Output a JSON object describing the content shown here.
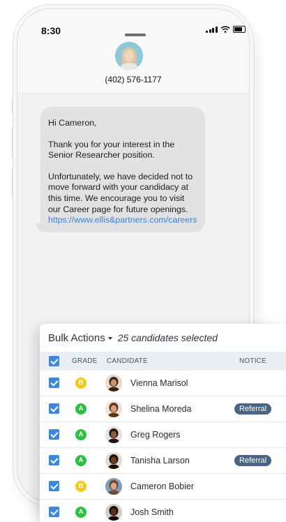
{
  "phone": {
    "status_time": "8:30",
    "contact_number": "(402) 576-1177"
  },
  "message": {
    "greeting": "Hi Cameron,",
    "paragraph1": "Thank you for your interest in the Senior Researcher position.",
    "paragraph2": "Unfortunately, we have decided not to move forward with your candidacy at this time. We encourage you to visit our Career page for future openings.",
    "link": "https://www.ellis&partners.com/careers"
  },
  "bulk": {
    "label": "Bulk Actions",
    "selected_text": "25 candidates selected",
    "columns": {
      "grade": "GRADE",
      "candidate": "CANDIDATE",
      "notice": "NOTICE"
    },
    "candidates": [
      {
        "name": "Vienna Marisol",
        "grade": "B",
        "notice": ""
      },
      {
        "name": "Shelina Moreda",
        "grade": "A",
        "notice": "Referral"
      },
      {
        "name": "Greg Rogers",
        "grade": "A",
        "notice": ""
      },
      {
        "name": "Tanisha Larson",
        "grade": "A",
        "notice": "Referral"
      },
      {
        "name": "Cameron Bobier",
        "grade": "B",
        "notice": ""
      },
      {
        "name": "Josh Smith",
        "grade": "A",
        "notice": ""
      }
    ]
  },
  "colors": {
    "grade_a": "#2cc043",
    "grade_b": "#f3cb13",
    "checkbox": "#3d88db",
    "badge": "#4a6584",
    "link": "#3a7fd6"
  },
  "icons": {
    "signal": "cellular-signal-icon",
    "wifi": "wifi-icon",
    "battery": "battery-icon",
    "checkbox": "checkbox-checked-icon",
    "caret": "caret-down-icon"
  }
}
